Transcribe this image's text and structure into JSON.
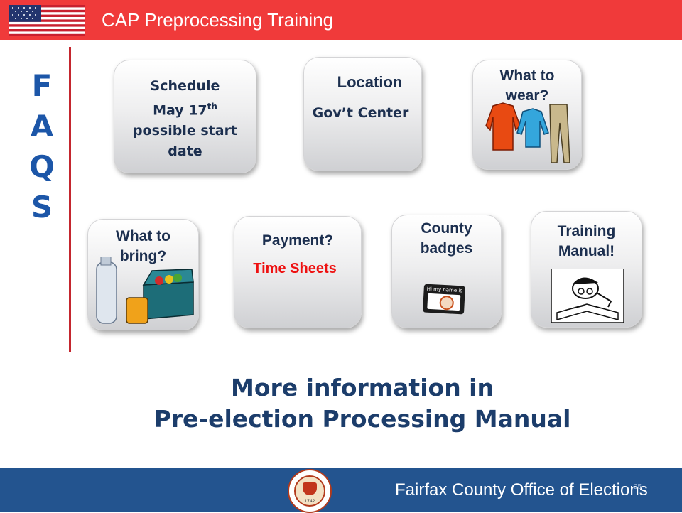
{
  "header": {
    "title": "CAP Preprocessing Training"
  },
  "faq": {
    "letters": [
      "F",
      "A",
      "Q",
      "S"
    ]
  },
  "tiles": {
    "schedule": {
      "line1": "Schedule",
      "line2": "May 17",
      "sup": "th",
      "line3": "possible start",
      "line4": "date"
    },
    "location": {
      "title": "Location",
      "value": "Gov’t Center"
    },
    "wear": {
      "line1": "What to",
      "line2": "wear?"
    },
    "bring": {
      "line1": "What to",
      "line2": "bring?"
    },
    "payment": {
      "title": "Payment?",
      "value": "Time Sheets"
    },
    "badges": {
      "line1": "County",
      "line2": "badges",
      "badge_text": "Hi my name is"
    },
    "manual": {
      "line1": "Training",
      "line2": "Manual!"
    }
  },
  "more_info": {
    "line1": "More information in",
    "line2": "Pre-election Processing Manual"
  },
  "seal": {
    "year": "1742"
  },
  "footer": {
    "text": "Fairfax County Office of Elections",
    "page_number": "25"
  },
  "colors": {
    "header": "#f03a3a",
    "footer": "#23548f",
    "faq": "#1c56a8",
    "accent_line": "#c4262e",
    "time_sheets": "#ee1111"
  },
  "icons": [
    "us-flag-icon",
    "clothes-icon",
    "cooler-icon",
    "name-badge-icon",
    "reading-person-icon",
    "county-seal-icon"
  ]
}
